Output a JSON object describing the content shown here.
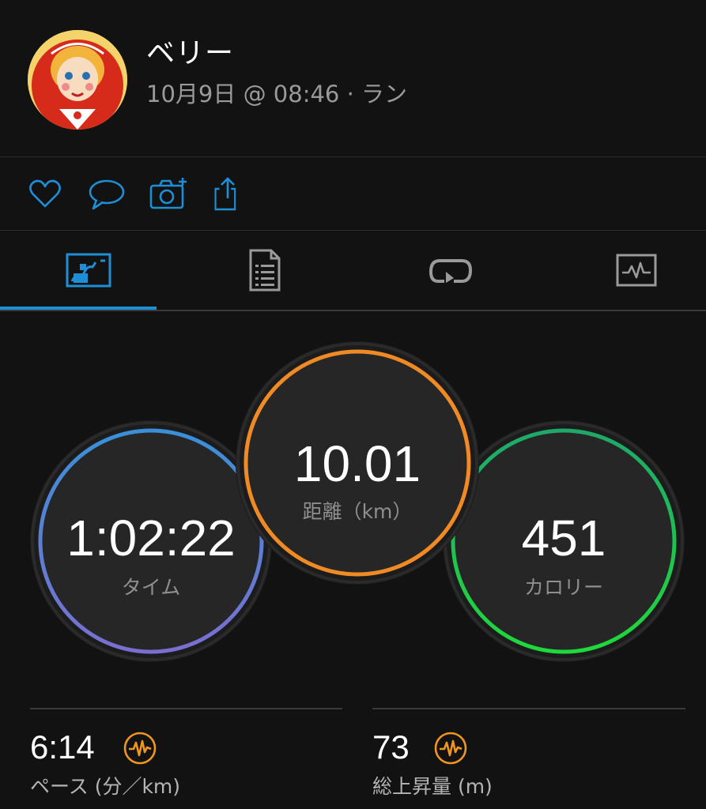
{
  "header": {
    "user_name": "ベリー",
    "meta": "10月9日 @ 08:46 · ラン"
  },
  "actions": [
    "heart-icon",
    "comment-icon",
    "camera-add-icon",
    "share-icon"
  ],
  "tabs": [
    "map-overview-icon",
    "details-icon",
    "laps-icon",
    "charts-icon"
  ],
  "active_tab": 0,
  "stats": {
    "time": {
      "value": "1:02:22",
      "label": "タイム"
    },
    "distance": {
      "value": "10.01",
      "label": "距離（km）"
    },
    "calories": {
      "value": "451",
      "label": "カロリー"
    }
  },
  "metrics": {
    "pace": {
      "value": "6:14",
      "label": "ペース (分／km)"
    },
    "elevation": {
      "value": "73",
      "label": "総上昇量 (m)"
    }
  },
  "colors": {
    "accent_blue": "#1e8fd6",
    "time_gradient": [
      "#3a8fd8",
      "#7a6fd0"
    ],
    "distance_ring": "#f08a24",
    "calories_gradient": [
      "#1fa86a",
      "#1fd93a"
    ],
    "metric_icon": "#f0951f"
  }
}
